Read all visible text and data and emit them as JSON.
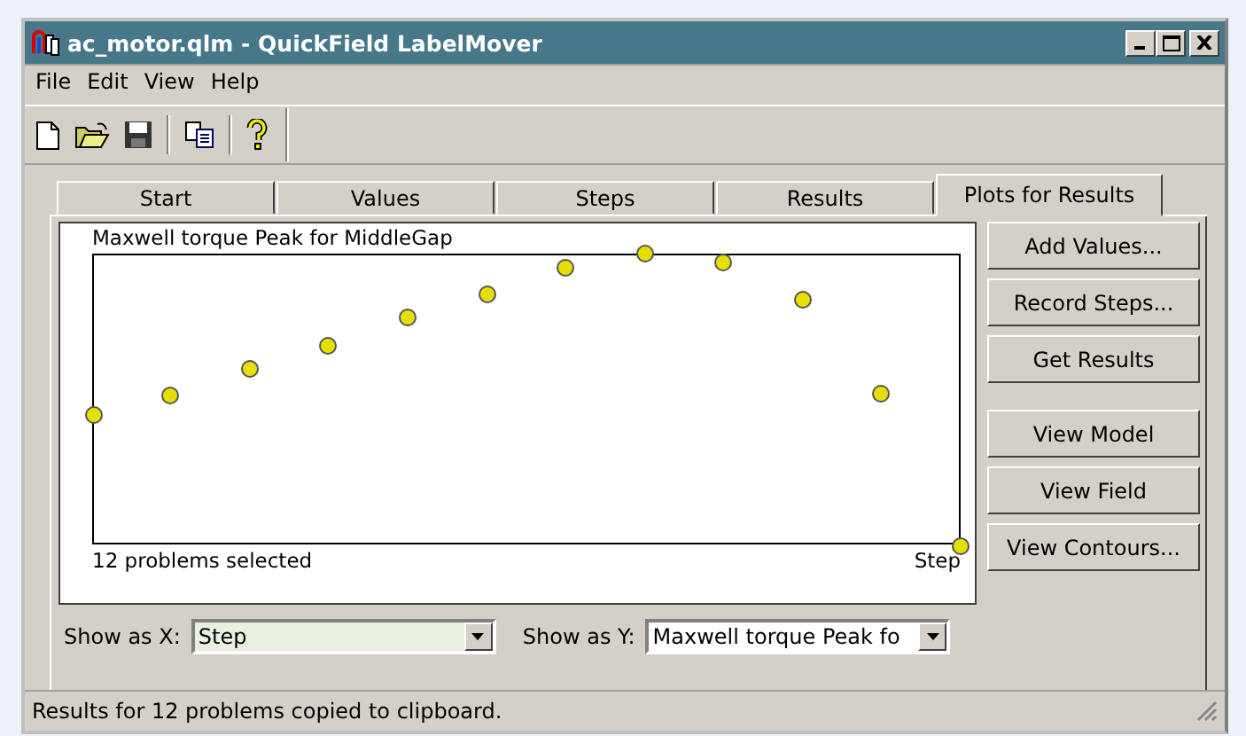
{
  "window": {
    "title": "ac_motor.qlm - QuickField LabelMover"
  },
  "menu": [
    "File",
    "Edit",
    "View",
    "Help"
  ],
  "tabs": [
    {
      "label": "Start",
      "selected": false
    },
    {
      "label": "Values",
      "selected": false
    },
    {
      "label": "Steps",
      "selected": false
    },
    {
      "label": "Results",
      "selected": false
    },
    {
      "label": "Plots for Results",
      "selected": true
    }
  ],
  "plot": {
    "title": "Maxwell torque Peak for MiddleGap",
    "footer": "12 problems selected",
    "x_label": "Step"
  },
  "buttons": [
    "Add Values...",
    "Record Steps...",
    "Get Results",
    "View Model",
    "View Field",
    "View Contours..."
  ],
  "show_x": {
    "label": "Show as X:",
    "value": "Step"
  },
  "show_y": {
    "label": "Show as Y:",
    "value": "Maxwell torque Peak fo"
  },
  "status_bar": "Results for 12 problems copied to clipboard."
}
